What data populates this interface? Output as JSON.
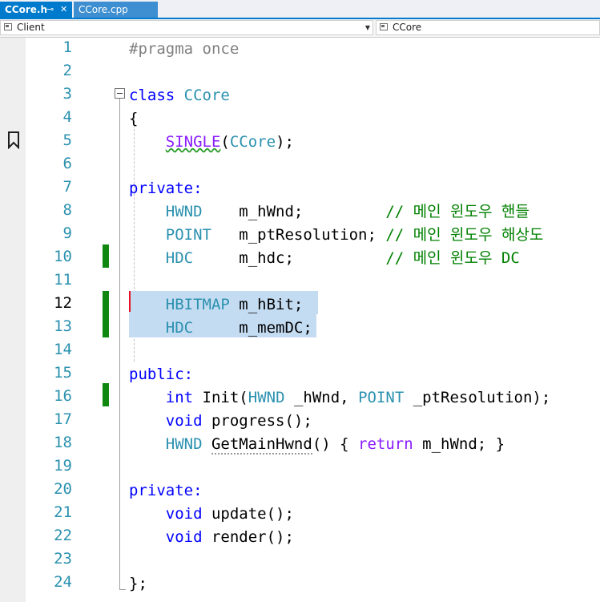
{
  "tabs": {
    "active": {
      "label": "CCore.h",
      "pin_glyph": "⊸",
      "close_glyph": "✕"
    },
    "inactive": {
      "label": "CCore.cpp"
    }
  },
  "navbar": {
    "project": "Client",
    "scope": "CCore"
  },
  "editor": {
    "line_numbers": [
      "1",
      "2",
      "3",
      "4",
      "5",
      "6",
      "7",
      "8",
      "9",
      "10",
      "11",
      "12",
      "13",
      "14",
      "15",
      "16",
      "17",
      "18",
      "19",
      "20",
      "21",
      "22",
      "23",
      "24"
    ],
    "current_line": "12",
    "code": {
      "l1": "#pragma once",
      "l3_kw": "class",
      "l3_name": "CCore",
      "l4": "{",
      "l5_macro": "SINGLE",
      "l5_open": "(",
      "l5_arg": "CCore",
      "l5_close": ");",
      "l7": "private:",
      "l8_type": "HWND",
      "l8_var": "m_hWnd;",
      "l8_comment": "// 메인 윈도우 핸들",
      "l9_type": "POINT",
      "l9_var": "m_ptResolution;",
      "l9_comment": "// 메인 윈도우 해상도",
      "l10_type": "HDC",
      "l10_var": "m_hdc;",
      "l10_comment": "// 메인 윈도우 DC",
      "l12_type": "HBITMAP",
      "l12_var": "m_hBit;",
      "l13_type": "HDC",
      "l13_var": "m_memDC;",
      "l15": "public:",
      "l16_kw": "int",
      "l16_fn": "Init(",
      "l16_t1": "HWND",
      "l16_p1": "_hWnd,",
      "l16_t2": "POINT",
      "l16_p2": "_ptResolution);",
      "l17_kw": "void",
      "l17_fn": "progress();",
      "l18_type": "HWND",
      "l18_fn": "GetMainHwnd",
      "l18_rest": "() {",
      "l18_ret": "return",
      "l18_tail": "m_hWnd; }",
      "l20": "private:",
      "l21_kw": "void",
      "l21_fn": "update();",
      "l22_kw": "void",
      "l22_fn": "render();",
      "l24": "};"
    },
    "colors": {
      "keyword": "#0000ff",
      "type": "#2b91af",
      "macro": "#8a1bff",
      "comment": "#008000",
      "change_bar": "#108810",
      "selection": "#c4dcf2"
    }
  }
}
